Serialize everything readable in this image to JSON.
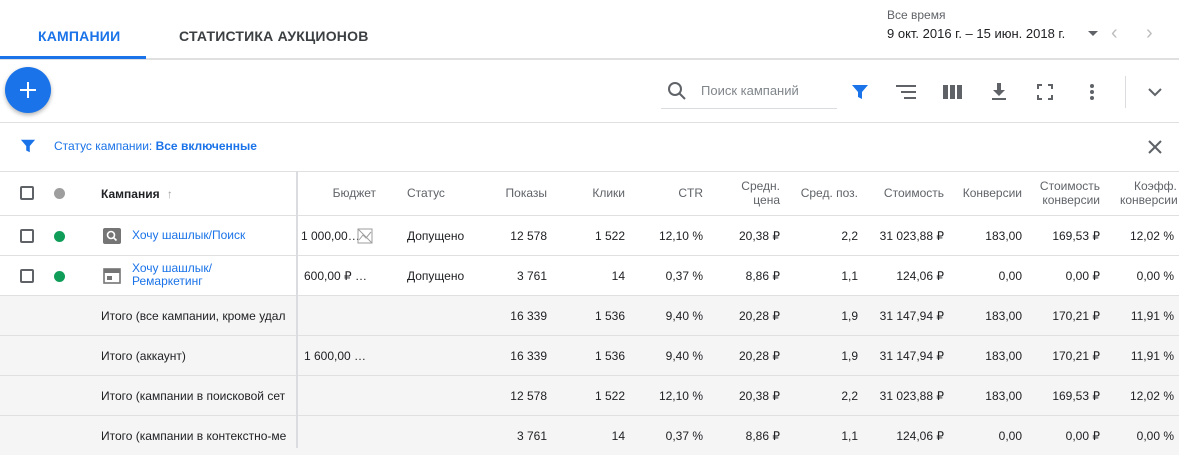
{
  "tabs": [
    {
      "label": "КАМПАНИИ",
      "active": true
    },
    {
      "label": "СТАТИСТИКА АУКЦИОНОВ",
      "active": false
    }
  ],
  "date_range": {
    "label": "Все время",
    "value": "9 окт. 2016 г. – 15 июн. 2018 г."
  },
  "search": {
    "placeholder": "Поиск кампаний",
    "value": ""
  },
  "filter": {
    "prefix": "Статус кампании:",
    "value": "Все включенные"
  },
  "colors": {
    "accent": "#1a73e8",
    "status_enabled": "#0f9d58"
  },
  "table": {
    "headers": {
      "campaign": "Кампания",
      "budget": "Бюджет",
      "status": "Статус",
      "impressions": "Показы",
      "clicks": "Клики",
      "ctr": "CTR",
      "avg_cpc_1": "Средн.",
      "avg_cpc_2": "цена",
      "avg_pos": "Сред. поз.",
      "cost": "Стоимость",
      "conversions": "Конверсии",
      "cost_conv_1": "Стоимость",
      "cost_conv_2": "конверсии",
      "conv_rate_1": "Коэфф.",
      "conv_rate_2": "конверсии"
    },
    "campaigns": [
      {
        "icon": "search-campaign-icon",
        "name_1": "Хочу шашлык/Поиск",
        "name_2": "",
        "budget": "1 000,00…",
        "status": "Допущено",
        "impressions": "12 578",
        "clicks": "1 522",
        "ctr": "12,10 %",
        "avg_cpc": "20,38 ₽",
        "avg_pos": "2,2",
        "cost": "31 023,88 ₽",
        "conversions": "183,00",
        "cost_conv": "169,53 ₽",
        "conv_rate": "12,02 %"
      },
      {
        "icon": "display-campaign-icon",
        "name_1": "Хочу шашлык/",
        "name_2": "Ремаркетинг",
        "budget": "600,00 ₽ …",
        "status": "Допущено",
        "impressions": "3 761",
        "clicks": "14",
        "ctr": "0,37 %",
        "avg_cpc": "8,86 ₽",
        "avg_pos": "1,1",
        "cost": "124,06 ₽",
        "conversions": "0,00",
        "cost_conv": "0,00 ₽",
        "conv_rate": "0,00 %"
      }
    ],
    "totals": [
      {
        "name": "Итого (все кампании, кроме удал",
        "budget": "",
        "impressions": "16 339",
        "clicks": "1 536",
        "ctr": "9,40 %",
        "avg_cpc": "20,28 ₽",
        "avg_pos": "1,9",
        "cost": "31 147,94 ₽",
        "conversions": "183,00",
        "cost_conv": "170,21 ₽",
        "conv_rate": "11,91 %"
      },
      {
        "name": "Итого (аккаунт)",
        "budget": "1 600,00 …",
        "impressions": "16 339",
        "clicks": "1 536",
        "ctr": "9,40 %",
        "avg_cpc": "20,28 ₽",
        "avg_pos": "1,9",
        "cost": "31 147,94 ₽",
        "conversions": "183,00",
        "cost_conv": "170,21 ₽",
        "conv_rate": "11,91 %"
      },
      {
        "name": "Итого (кампании в поисковой сет",
        "budget": "",
        "impressions": "12 578",
        "clicks": "1 522",
        "ctr": "12,10 %",
        "avg_cpc": "20,38 ₽",
        "avg_pos": "2,2",
        "cost": "31 023,88 ₽",
        "conversions": "183,00",
        "cost_conv": "169,53 ₽",
        "conv_rate": "12,02 %"
      },
      {
        "name": "Итого (кампании в контекстно-ме",
        "budget": "",
        "impressions": "3 761",
        "clicks": "14",
        "ctr": "0,37 %",
        "avg_cpc": "8,86 ₽",
        "avg_pos": "1,1",
        "cost": "124,06 ₽",
        "conversions": "0,00",
        "cost_conv": "0,00 ₽",
        "conv_rate": "0,00 %"
      }
    ]
  }
}
